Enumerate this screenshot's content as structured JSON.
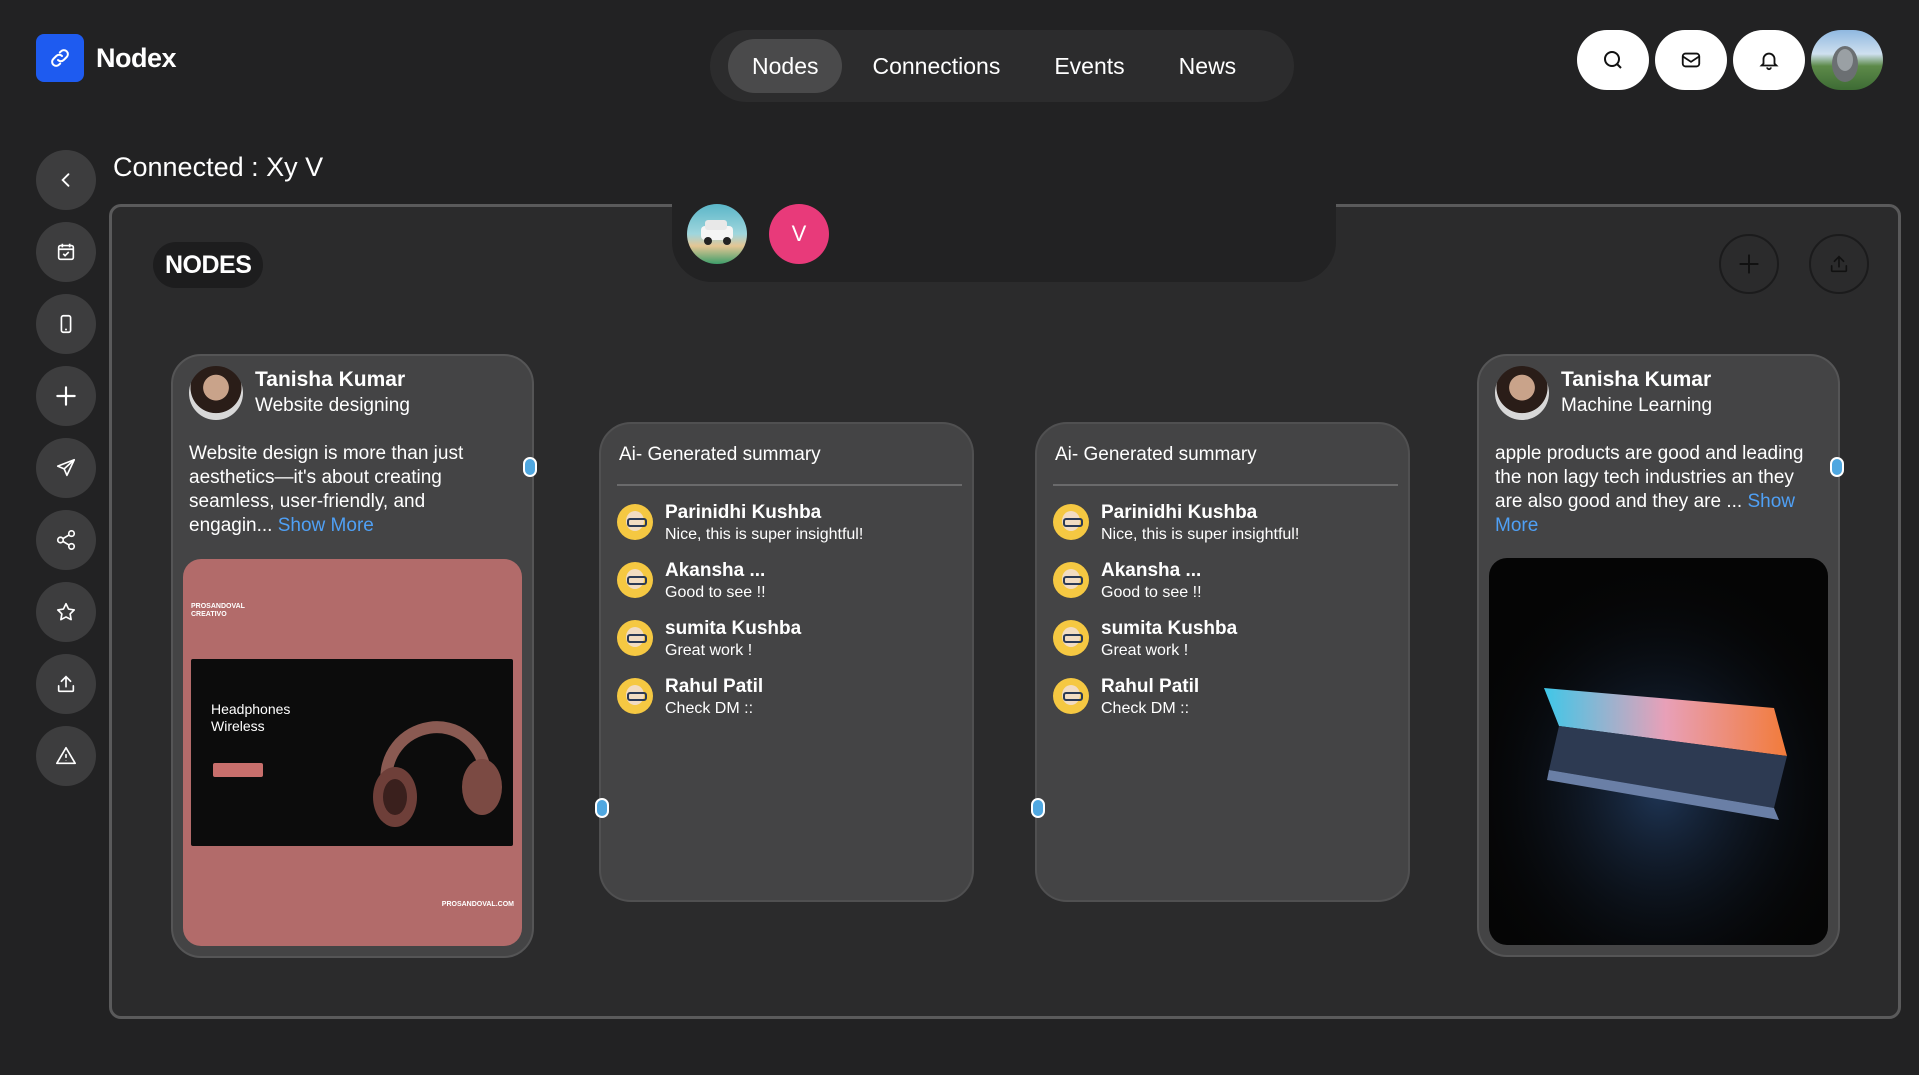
{
  "app": {
    "name": "Nodex"
  },
  "nav": {
    "tabs": [
      "Nodes",
      "Connections",
      "Events",
      "News"
    ]
  },
  "page": {
    "title": "Connected : Xy V"
  },
  "panel": {
    "badge": "NODES",
    "member_initial": "V"
  },
  "posts": [
    {
      "name": "Tanisha Kumar",
      "subtitle": "Website designing",
      "text": "Website design is more than just aesthetics—it's about creating seamless, user-friendly, and engagin...",
      "more": "Show More",
      "image": {
        "brand": "PROSANDOVAL CREATIVO",
        "headline": "Headphones Wireless",
        "footer": "PROSANDOVAL.COM"
      }
    },
    {
      "name": "Tanisha Kumar",
      "subtitle": "Machine Learning",
      "text": "apple products are good and leading the non lagy tech industries an they are also good and they are ...",
      "more": "Show More"
    }
  ],
  "summaries": [
    {
      "title": "Ai- Generated summary",
      "comments": [
        {
          "name": "Parinidhi Kushba",
          "message": "Nice, this is super insightful!"
        },
        {
          "name": "Akansha ...",
          "message": "Good to see !!"
        },
        {
          "name": "sumita Kushba",
          "message": "Great work !"
        },
        {
          "name": "Rahul Patil",
          "message": "Check DM ::"
        }
      ]
    },
    {
      "title": "Ai- Generated summary",
      "comments": [
        {
          "name": "Parinidhi Kushba",
          "message": "Nice, this is super insightful!"
        },
        {
          "name": "Akansha ...",
          "message": "Good to see !!"
        },
        {
          "name": "sumita Kushba",
          "message": "Great work !"
        },
        {
          "name": "Rahul Patil",
          "message": "Check DM ::"
        }
      ]
    }
  ],
  "colors": {
    "background": "#222223",
    "accent": "#1e5bf0",
    "link": "#4fa0f5",
    "avatar_pink": "#e83a7a"
  },
  "icons": {
    "logo": "link-icon",
    "header": [
      "search-icon",
      "mail-icon",
      "bell-icon"
    ],
    "sidebar": [
      "chevron-left-icon",
      "calendar-check-icon",
      "phone-icon",
      "plus-icon",
      "send-icon",
      "share-icon",
      "star-icon",
      "upload-icon",
      "warning-icon"
    ],
    "panel": [
      "plus-icon",
      "upload-icon"
    ]
  }
}
